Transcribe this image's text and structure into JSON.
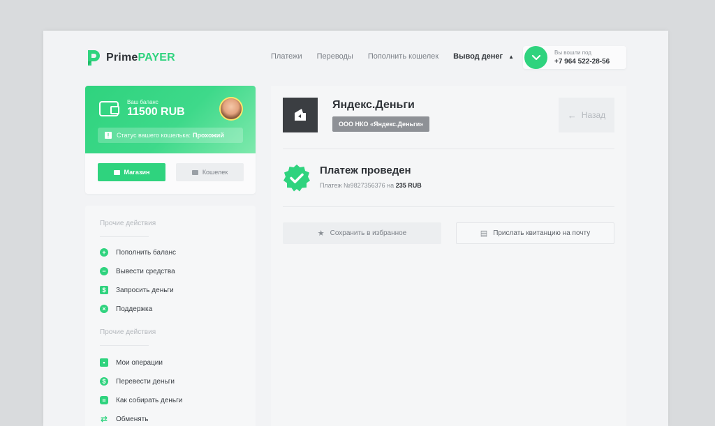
{
  "brand": {
    "name_prime": "Prime",
    "name_payer": "PAYER",
    "accent": "#2fd37e"
  },
  "nav": {
    "items": [
      "Платежи",
      "Переводы",
      "Пополнить кошелек"
    ],
    "active": "Вывод денег"
  },
  "user": {
    "label": "Вы вошли под",
    "phone": "+7 964 522-28-56"
  },
  "balance": {
    "label": "Ваш баланс",
    "value": "11500 RUB",
    "status_text": "Статус вашего кошелька:",
    "status_value": "Прохожий",
    "shop_label": "Магазин",
    "wallet_label": "Кошелек"
  },
  "actions": {
    "section1": "Прочие действия",
    "items1": [
      "Пополнить баланс",
      "Вывести средства",
      "Запросить деньги",
      "Поддержка"
    ],
    "section2": "Прочие действия",
    "items2": [
      "Мои операции",
      "Перевести деньги",
      "Как собирать деньги",
      "Обменять"
    ]
  },
  "payment": {
    "provider": "Яндекс.Деньги",
    "provider_badge": "ООО НКО «Яндекс.Деньги»",
    "back_label": "Назад",
    "status_title": "Платеж проведен",
    "number_text": "Платеж №9827356376 на",
    "amount": "235 RUB",
    "fav_label": "Сохранить в избранное",
    "mail_label": "Прислать квитанцию на почту"
  }
}
